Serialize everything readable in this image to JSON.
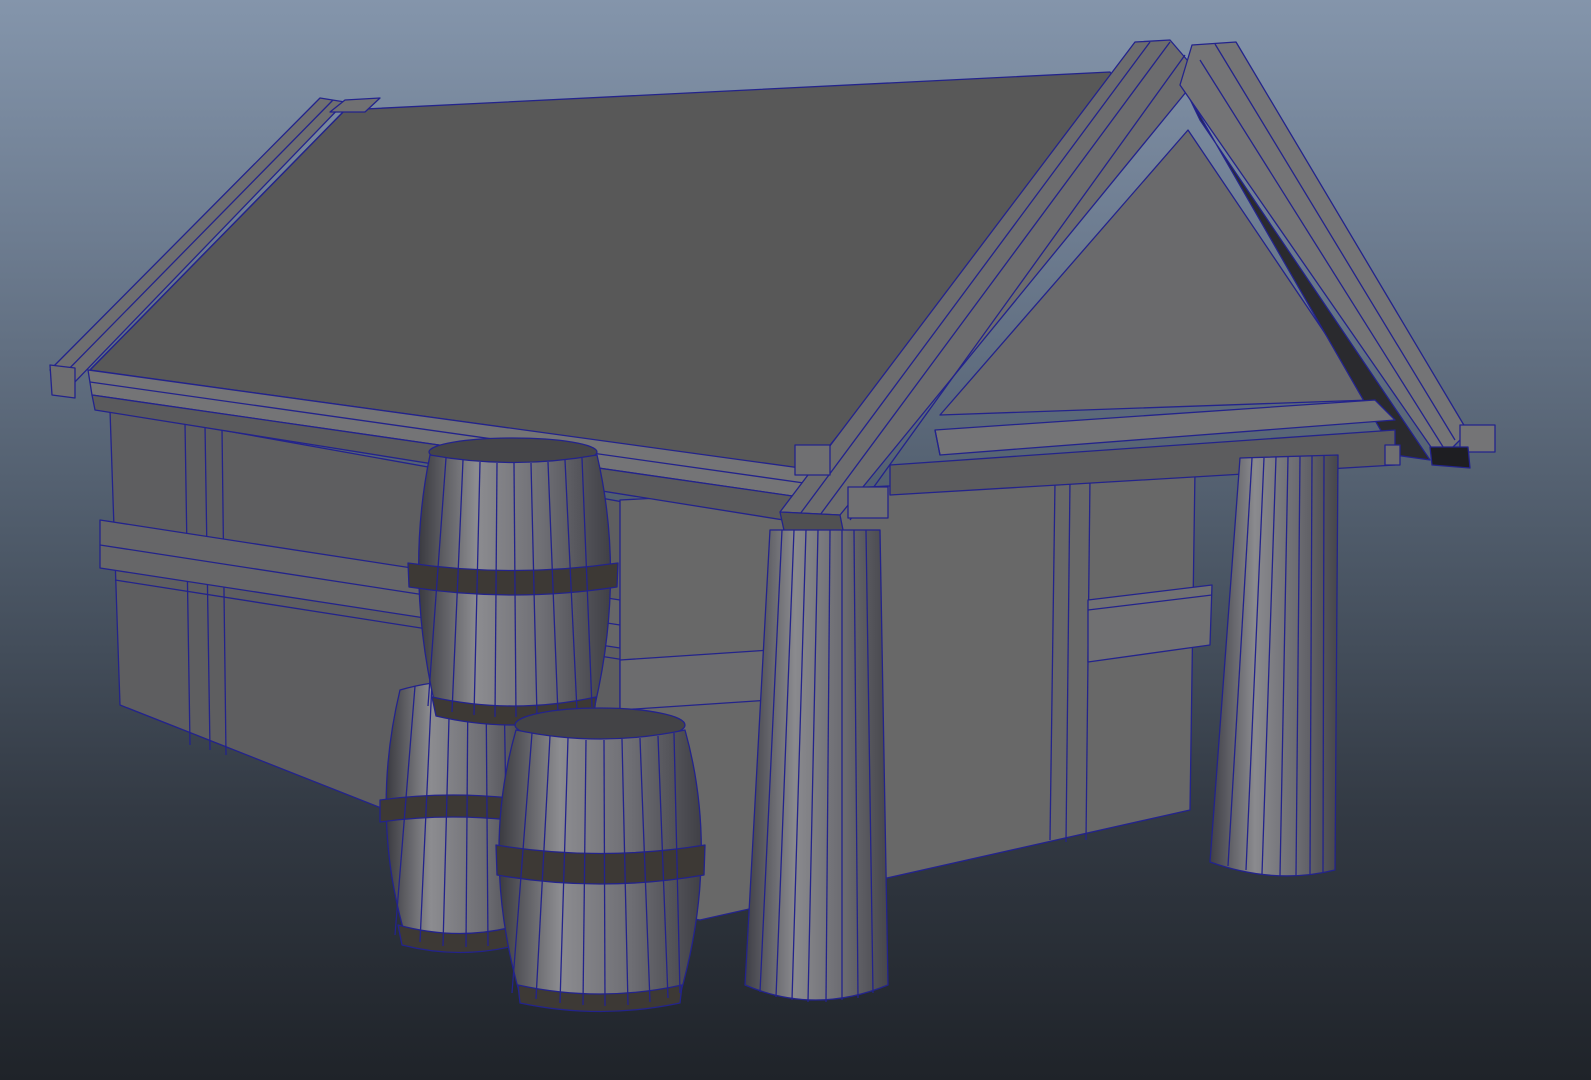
{
  "viewport": {
    "background_top": "#8495ab",
    "background_bottom": "#1f2329",
    "wireframe_color": "#23238c",
    "shaded_surface_color": "#6b6b6b"
  },
  "scene": {
    "object": "house",
    "parts": [
      "roof",
      "walls",
      "gable",
      "front-beam",
      "posts",
      "barrels"
    ],
    "barrel_count": 3,
    "post_count": 2
  }
}
